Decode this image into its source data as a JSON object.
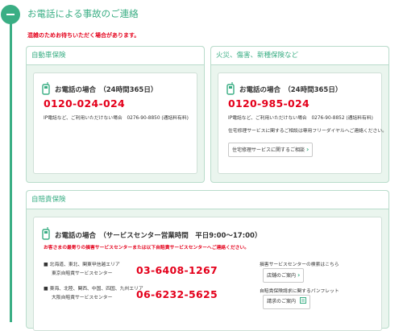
{
  "section": {
    "title": "お電話による事故のご連絡",
    "notice": "混雑のためお待ちいただく場合があります。"
  },
  "auto": {
    "title": "自動車保険",
    "tel_heading": "お電話の場合　（24時間365日）",
    "tel_number": "0120-024-024",
    "ip_note": "IP電話など、ご利用いただけない場合　0276-90-8850 (通話料有料)"
  },
  "fire": {
    "title": "火災、傷害、新種保険など",
    "tel_heading": "お電話の場合　（24時間365日）",
    "tel_number": "0120-985-024",
    "ip_note": "IP電話など、ご利用いただけない場合　0276-90-8852 (通話料有料)",
    "repair_note": "住宅修理サービスに関するご相談は専用フリーダイヤルへご連絡ください。",
    "repair_button": "住宅修理サービスに関するご相談"
  },
  "jibaiseki": {
    "title": "自賠責保険",
    "tel_heading": "お電話の場合　（サービスセンター営業時間　平日9:00～17:00）",
    "notice": "お客さまの最寄りの損害サービスセンターまたは以下自賠責サービスセンターへご連絡ください。",
    "east": {
      "area": "北海道、東北、関東甲信越エリア",
      "center": "東京自賠責サービスセンター",
      "number": "03-6408-1267"
    },
    "west": {
      "area": "東海、北陸、関西、中国、四国、九州エリア",
      "center": "大阪自賠責サービスセンター",
      "number": "06-6232-5625"
    },
    "side1_text": "損害サービスセンターの検索はこちら",
    "side1_button": "店舗のご案内",
    "side2_text": "自賠責保険請求に関するパンフレット",
    "side2_button": "請求のご案内"
  }
}
